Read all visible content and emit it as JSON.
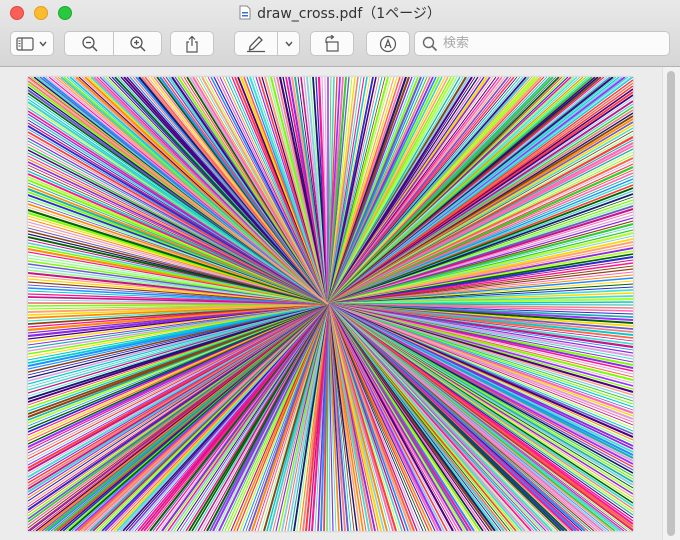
{
  "window": {
    "title": "draw_cross.pdf（1ページ）",
    "traffic_lights": [
      "#fc5f57",
      "#fdbc2e",
      "#28c840"
    ]
  },
  "toolbar": {
    "icons": [
      "sidebar-icon",
      "chevron-down-icon",
      "zoom-out-icon",
      "zoom-in-icon",
      "share-icon",
      "markup-pen-icon",
      "chevron-down-icon",
      "rotate-icon",
      "annotate-icon"
    ],
    "search": {
      "placeholder": "検索",
      "value": ""
    }
  },
  "document": {
    "pattern": "radial-lines",
    "colors": [
      "#ff3b3b",
      "#2a2ad0",
      "#40e0d0",
      "#7cfc00",
      "#ff8c00",
      "#9b30ff",
      "#ff69b4",
      "#1e90ff",
      "#32cd32",
      "#ffd700",
      "#8b4513",
      "#00ced1",
      "#4b0082",
      "#ff1493",
      "#98fb98",
      "#ffa07a",
      "#6a5acd",
      "#20b2aa",
      "#dda0dd",
      "#006400",
      "#ff6347",
      "#87ceeb",
      "#8a2be2",
      "#adff2f",
      "#191970",
      "#f08080",
      "#48d1cc",
      "#c71585"
    ]
  }
}
